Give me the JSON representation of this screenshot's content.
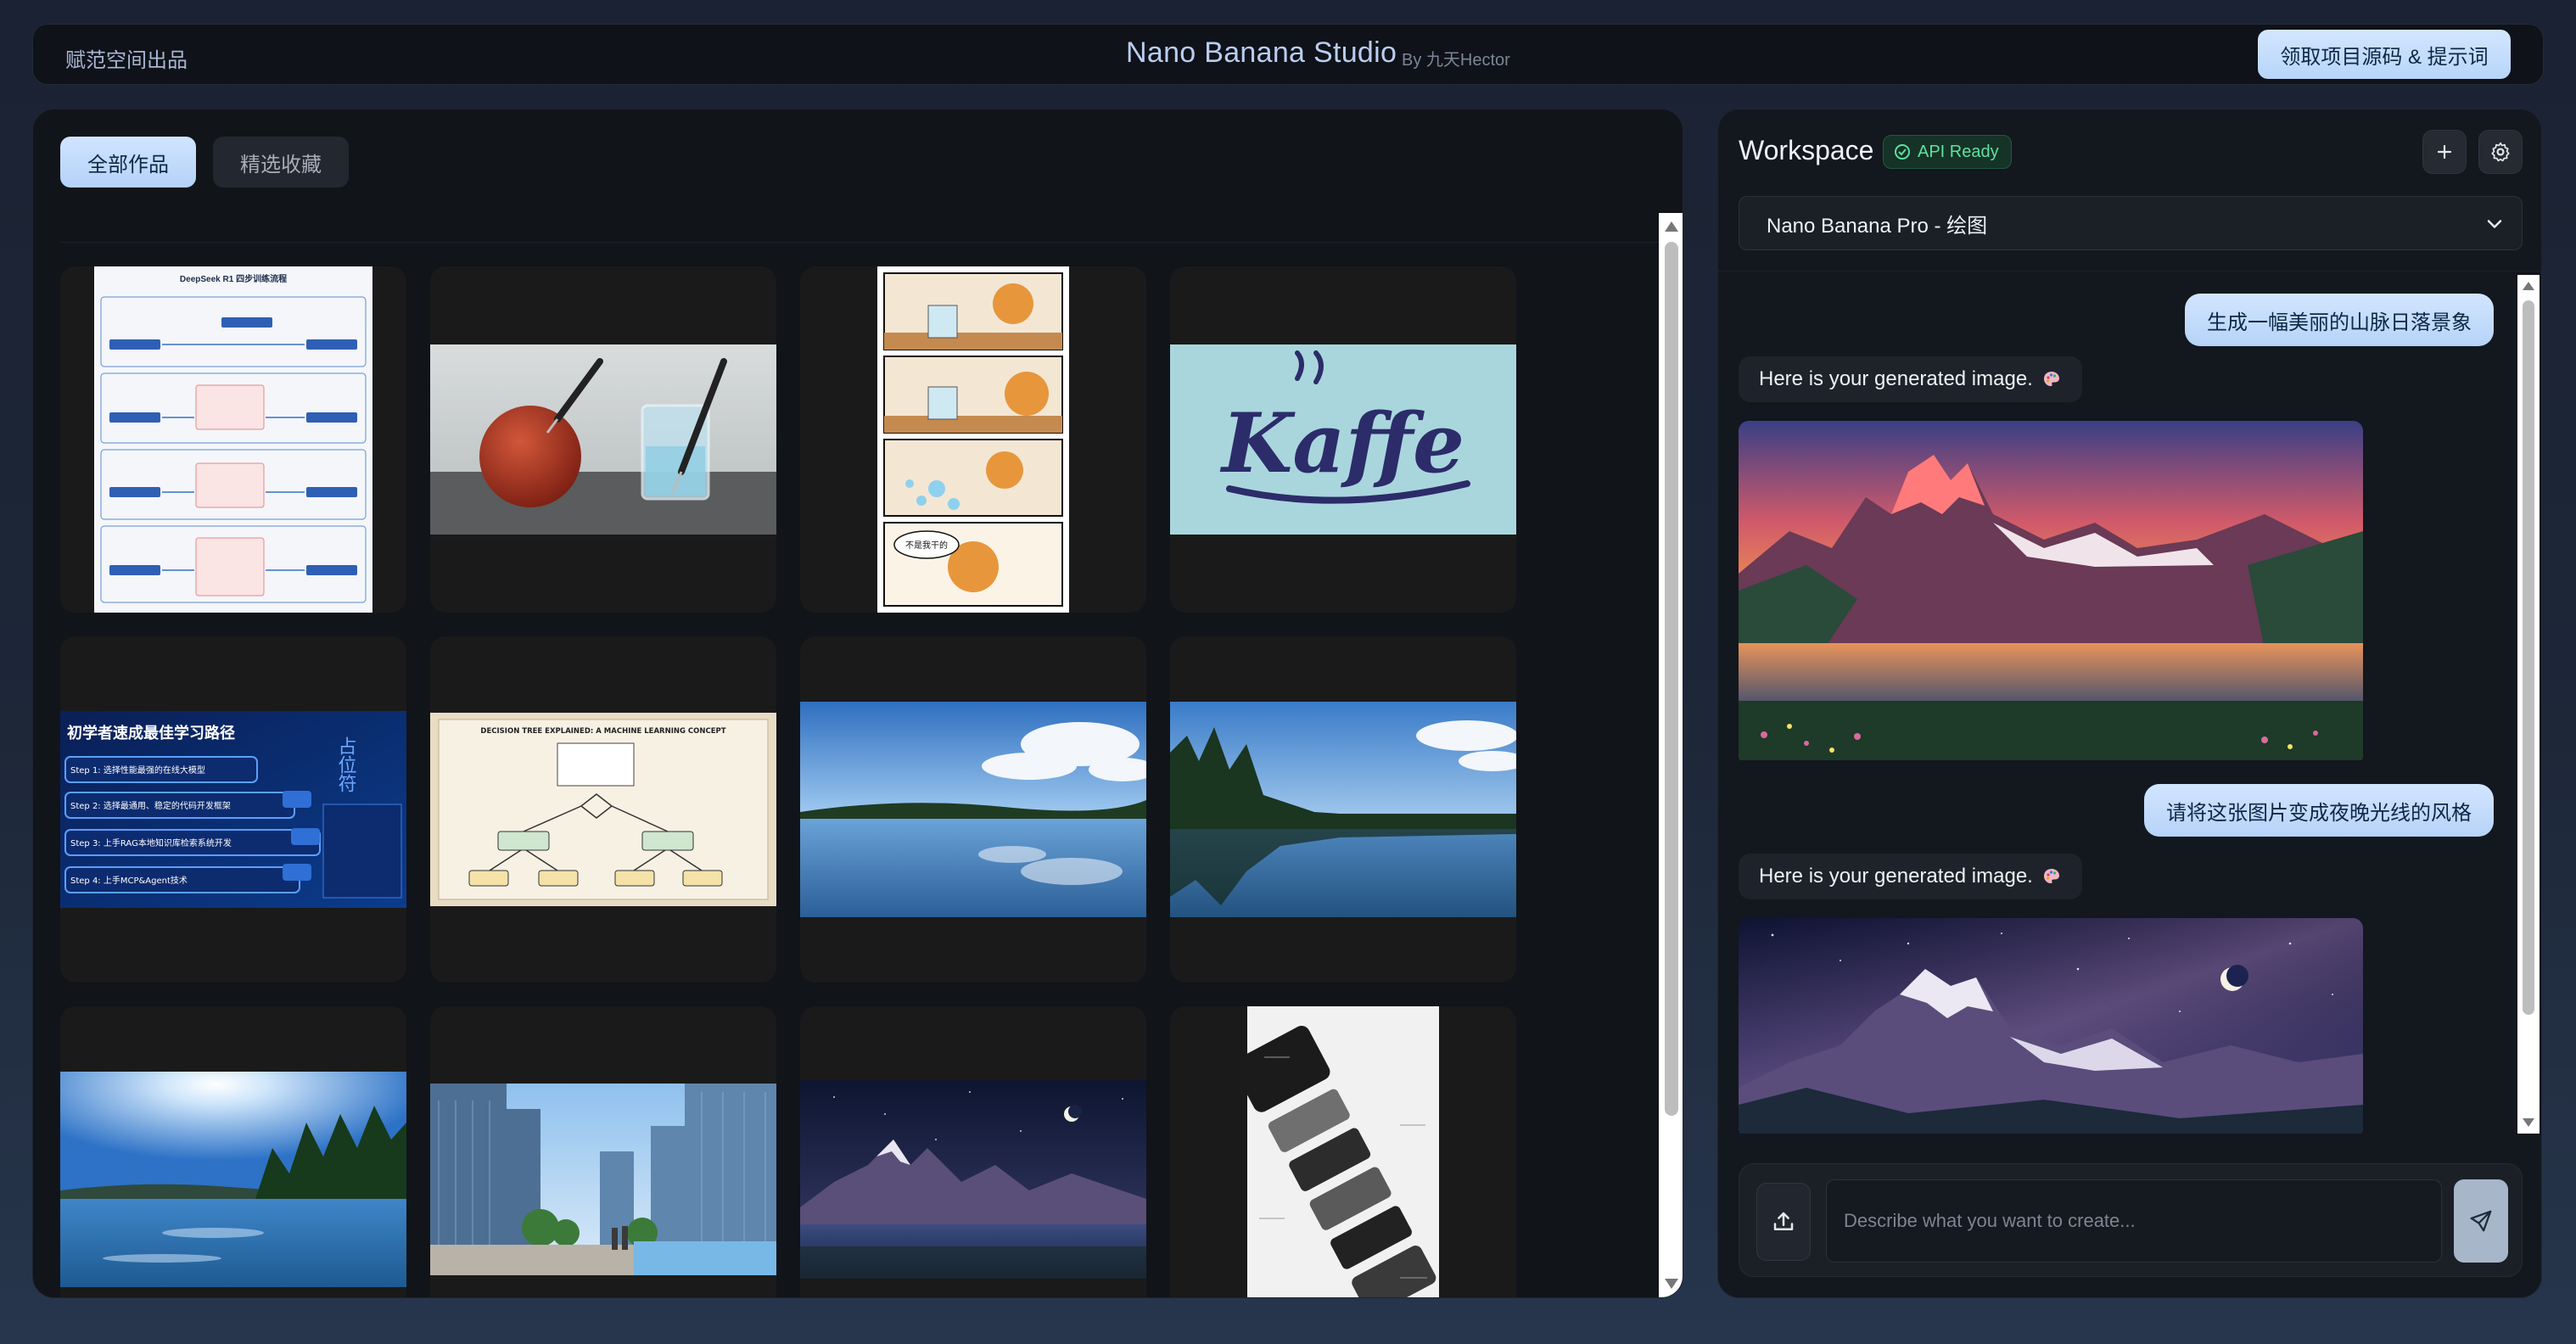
{
  "header": {
    "brand": "赋范空间出品",
    "title": "Nano Banana Studio",
    "byline": "By 九天Hector",
    "cta_label": "领取项目源码 & 提示词"
  },
  "gallery": {
    "tabs": [
      {
        "label": "全部作品",
        "active": true
      },
      {
        "label": "精选收藏",
        "active": false
      }
    ],
    "tiles": [
      {
        "subject": "deepseek-flowchart",
        "caption": "DeepSeek R1 四步训练流程"
      },
      {
        "subject": "tomato-thermometer"
      },
      {
        "subject": "cat-comic",
        "caption": "不是我干的"
      },
      {
        "subject": "kaffe-logo",
        "caption": "Kaffe"
      },
      {
        "subject": "learning-path-infographic",
        "caption": "初学者速成最佳学习路径",
        "side_text": "占位符",
        "steps": [
          "Step 1: 选择性能最强的在线大模型",
          "Step 2: 选择最通用、稳定的代码开发框架",
          "Step 3: 上手RAG本地知识库检索系统开发",
          "Step 4: 上手MCP&Agent技术"
        ]
      },
      {
        "subject": "decision-tree-diagram",
        "caption": "DECISION TREE EXPLAINED: A MACHINE LEARNING CONCEPT"
      },
      {
        "subject": "lake-cloudy"
      },
      {
        "subject": "lake-forest"
      },
      {
        "subject": "lake-sunny"
      },
      {
        "subject": "city-street"
      },
      {
        "subject": "mountain-night"
      },
      {
        "subject": "phone-exploded"
      }
    ]
  },
  "workspace": {
    "title": "Workspace",
    "api_status": "API Ready",
    "model": "Nano Banana Pro - 绘图",
    "messages": [
      {
        "role": "user",
        "text": "生成一幅美丽的山脉日落景象"
      },
      {
        "role": "assistant",
        "text": "Here is your generated image."
      },
      {
        "role": "user",
        "text": "请将这张图片变成夜晚光线的风格"
      },
      {
        "role": "assistant",
        "text": "Here is your generated image."
      }
    ],
    "composer": {
      "placeholder": "Describe what you want to create..."
    }
  },
  "colors": {
    "accent": "#b9d6fa",
    "api_ready": "#5fe0a0",
    "panel": "#111419"
  }
}
